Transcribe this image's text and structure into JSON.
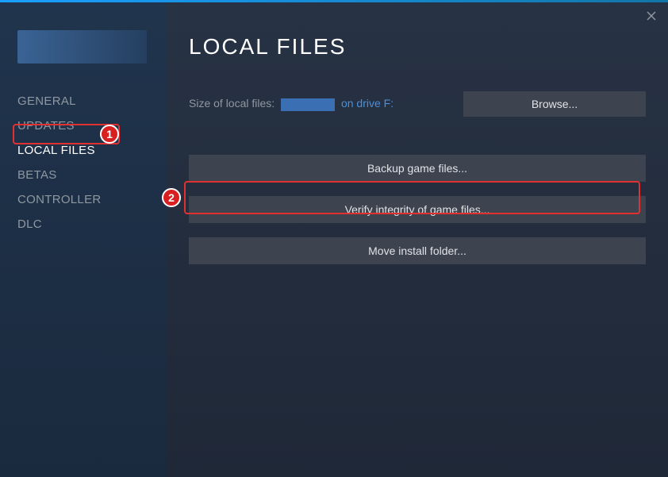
{
  "sidebar": {
    "items": [
      {
        "label": "GENERAL"
      },
      {
        "label": "UPDATES"
      },
      {
        "label": "LOCAL FILES"
      },
      {
        "label": "BETAS"
      },
      {
        "label": "CONTROLLER"
      },
      {
        "label": "DLC"
      }
    ]
  },
  "main": {
    "title": "LOCAL FILES",
    "size_prefix": "Size of local files:",
    "drive_text": "on drive F:",
    "browse_label": "Browse...",
    "backup_label": "Backup game files...",
    "verify_label": "Verify integrity of game files...",
    "move_label": "Move install folder..."
  },
  "annotations": {
    "badge1": "1",
    "badge2": "2"
  }
}
